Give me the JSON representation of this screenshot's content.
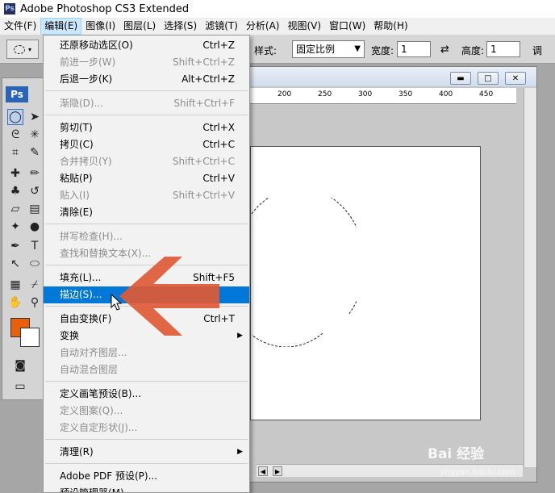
{
  "titlebar": {
    "logo": "Ps",
    "title": "Adobe Photoshop CS3 Extended"
  },
  "menubar": {
    "items": [
      "文件(F)",
      "编辑(E)",
      "图像(I)",
      "图层(L)",
      "选择(S)",
      "滤镜(T)",
      "分析(A)",
      "视图(V)",
      "窗口(W)",
      "帮助(H)"
    ]
  },
  "options": {
    "style_label": "样式:",
    "style_value": "固定比例",
    "width_label": "宽度:",
    "width_value": "1",
    "height_label": "高度:",
    "height_value": "1",
    "cut_label": "调"
  },
  "tools": {
    "logo": "Ps",
    "fg_color": "#e8600c"
  },
  "ruler": {
    "ticks": [
      "200",
      "250",
      "300",
      "350",
      "400",
      "450"
    ]
  },
  "edit_menu": {
    "items": [
      {
        "label": "还原移动选区(O)",
        "shortcut": "Ctrl+Z"
      },
      {
        "label": "前进一步(W)",
        "shortcut": "Shift+Ctrl+Z"
      },
      {
        "label": "后退一步(K)",
        "shortcut": "Alt+Ctrl+Z"
      },
      {
        "label": "渐隐(D)...",
        "shortcut": "Shift+Ctrl+F"
      },
      {
        "label": "剪切(T)",
        "shortcut": "Ctrl+X"
      },
      {
        "label": "拷贝(C)",
        "shortcut": "Ctrl+C"
      },
      {
        "label": "合并拷贝(Y)",
        "shortcut": "Shift+Ctrl+C"
      },
      {
        "label": "粘贴(P)",
        "shortcut": "Ctrl+V"
      },
      {
        "label": "贴入(I)",
        "shortcut": "Shift+Ctrl+V"
      },
      {
        "label": "清除(E)",
        "shortcut": ""
      },
      {
        "label": "拼写检查(H)...",
        "shortcut": ""
      },
      {
        "label": "查找和替换文本(X)...",
        "shortcut": ""
      },
      {
        "label": "填充(L)...",
        "shortcut": "Shift+F5"
      },
      {
        "label": "描边(S)...",
        "shortcut": ""
      },
      {
        "label": "自由变换(F)",
        "shortcut": "Ctrl+T"
      },
      {
        "label": "变换",
        "shortcut": ""
      },
      {
        "label": "自动对齐图层...",
        "shortcut": ""
      },
      {
        "label": "自动混合图层",
        "shortcut": ""
      },
      {
        "label": "定义画笔预设(B)...",
        "shortcut": ""
      },
      {
        "label": "定义图案(Q)...",
        "shortcut": ""
      },
      {
        "label": "定义自定形状(J)...",
        "shortcut": ""
      },
      {
        "label": "清理(R)",
        "shortcut": ""
      },
      {
        "label": "Adobe PDF 预设(P)...",
        "shortcut": ""
      },
      {
        "label": "预设管理器(M)...",
        "shortcut": ""
      }
    ]
  },
  "watermark": {
    "text": "Bai 经验",
    "sub": "jingyan.baidu.com"
  }
}
